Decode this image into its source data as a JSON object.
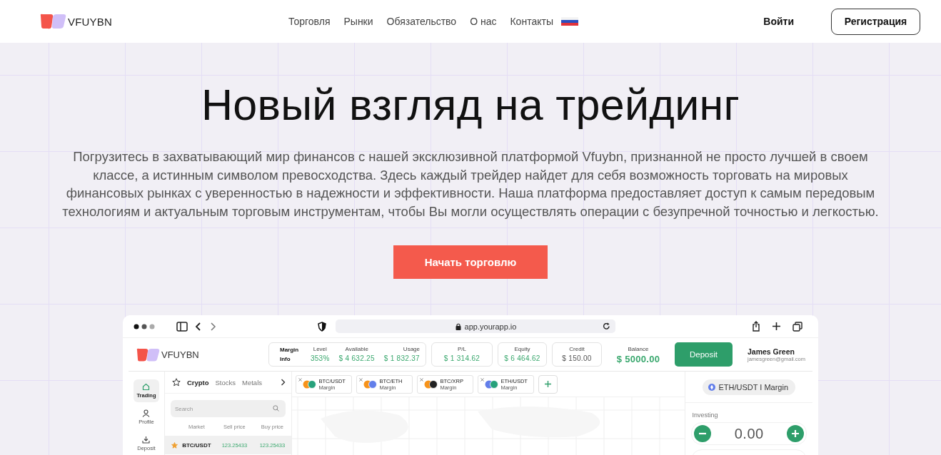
{
  "header": {
    "logo": "VFUYBN",
    "nav": [
      {
        "label": "Торговля"
      },
      {
        "label": "Рынки"
      },
      {
        "label": "Обязательство"
      },
      {
        "label": "О нас"
      },
      {
        "label": "Контакты"
      }
    ],
    "login": "Войти",
    "register": "Регистрация"
  },
  "hero": {
    "title": "Новый взгляд на трейдинг",
    "text": "Погрузитесь в захватывающий мир финансов с нашей эксклюзивной платформой Vfuybn, признанной не просто лучшей в своем классе, а истинным символом превосходства. Здесь каждый трейдер найдет для себя возможность торговать на мировых финансовых рынках с уверенностью в надежности и эффективности. Наша платформа предоставляет доступ к самым передовым технологиям и актуальным торговым инструментам, чтобы Вы могли осуществлять операции с безупречной точностью и легкостью.",
    "cta": "Начать торговлю"
  },
  "app": {
    "url": "app.yourapp.io",
    "logo": "VFUYBN",
    "margin": {
      "label": "Margin Info",
      "stats": [
        {
          "label": "Level",
          "value": "353%"
        },
        {
          "label": "Available",
          "value": "$ 4 632.25"
        },
        {
          "label": "Usage",
          "value": "$ 1 832.37"
        }
      ]
    },
    "cards": [
      {
        "label": "P/L",
        "value": "$ 1 314.62",
        "kind": "positive"
      },
      {
        "label": "Equity",
        "value": "$ 6 464.62",
        "kind": "positive"
      },
      {
        "label": "Credit",
        "value": "$ 150.00",
        "kind": "neutral"
      }
    ],
    "balance": {
      "label": "Balance",
      "value": "$ 5000.00"
    },
    "deposit": "Deposit",
    "user": {
      "name": "James Green",
      "email": "jamesgreen@gmail.com"
    },
    "nav": [
      {
        "label": "Trading",
        "selected": true
      },
      {
        "label": "Profile",
        "selected": false
      },
      {
        "label": "Deposit",
        "selected": false
      }
    ],
    "market_tabs": [
      {
        "label": "Crypto",
        "selected": true
      },
      {
        "label": "Stocks",
        "selected": false
      },
      {
        "label": "Metals",
        "selected": false
      }
    ],
    "search": {
      "placeholder": "Search"
    },
    "columns": [
      "Market",
      "Sell price",
      "Buy price"
    ],
    "rows": [
      {
        "market": "BTC/USDT",
        "sell": "123.25433",
        "buy": "123.25433",
        "favorite": true,
        "selected": true
      }
    ],
    "pairs": [
      {
        "name": "BTC/USDT",
        "sub": "Margin"
      },
      {
        "name": "BTC/ETH",
        "sub": "Margin"
      },
      {
        "name": "BTC/XRP",
        "sub": "Margin"
      },
      {
        "name": "ETH/USDT",
        "sub": "Margin"
      }
    ],
    "order": {
      "pair": "ETH/USDT I Margin",
      "label": "Investing",
      "amount": "0.00"
    }
  }
}
